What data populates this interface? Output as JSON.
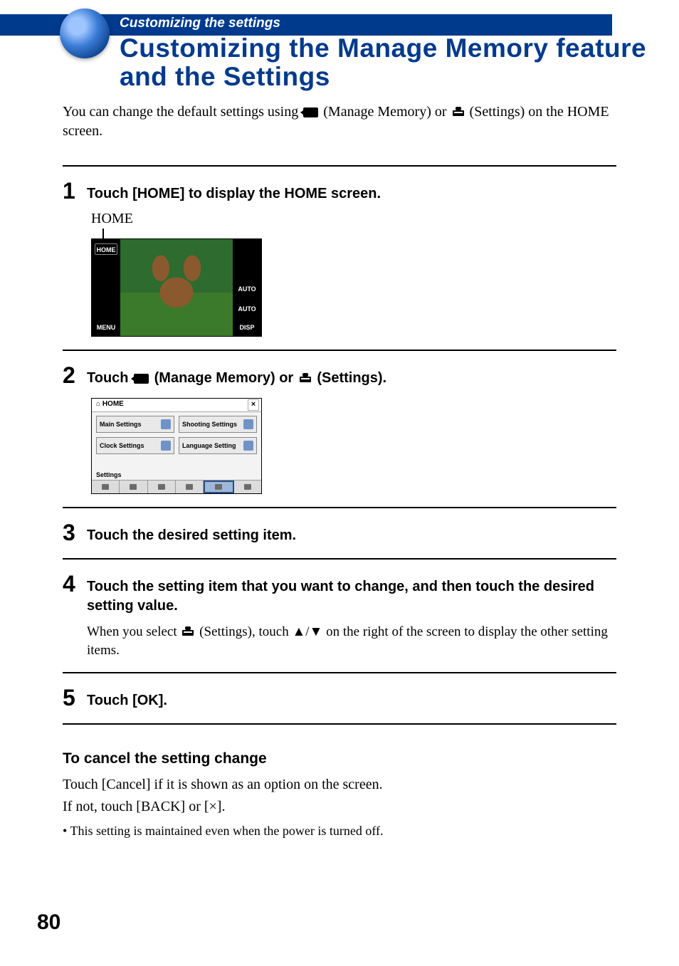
{
  "header": {
    "breadcrumb": "Customizing the settings",
    "title": "Customizing the Manage Memory feature and the Settings"
  },
  "intro": {
    "pre": "You can change the default settings using ",
    "mm": " (Manage Memory) or ",
    "gear": " (Settings) on the HOME screen."
  },
  "steps": {
    "s1": {
      "num": "1",
      "text": "Touch [HOME] to display the HOME screen.",
      "caption": "HOME"
    },
    "s2": {
      "num": "2",
      "pre": "Touch ",
      "mm": " (Manage Memory) or ",
      "gear": " (Settings)."
    },
    "s3": {
      "num": "3",
      "text": "Touch the desired setting item."
    },
    "s4": {
      "num": "4",
      "text": "Touch the setting item that you want to change, and then touch the desired setting value.",
      "sub_pre": "When you select ",
      "sub_post": " (Settings), touch ▲/▼ on the right of the screen to display the other setting items."
    },
    "s5": {
      "num": "5",
      "text": "Touch [OK]."
    }
  },
  "cam1": {
    "left": {
      "home": "HOME",
      "menu": "MENU"
    },
    "right": {
      "auto1": "AUTO",
      "auto2": "AUTO",
      "disp": "DISP"
    }
  },
  "cam2": {
    "home": "HOME",
    "close": "×",
    "cells": {
      "a": "Main Settings",
      "b": "Shooting Settings",
      "c": "Clock Settings",
      "d": "Language Setting"
    },
    "tab": "Settings"
  },
  "cancel": {
    "heading": "To cancel the setting change",
    "p1": "Touch [Cancel] if it is shown as an option on the screen.",
    "p2": "If not, touch [BACK] or [×].",
    "bullet": "This setting is maintained even when the power is turned off."
  },
  "page_number": "80"
}
